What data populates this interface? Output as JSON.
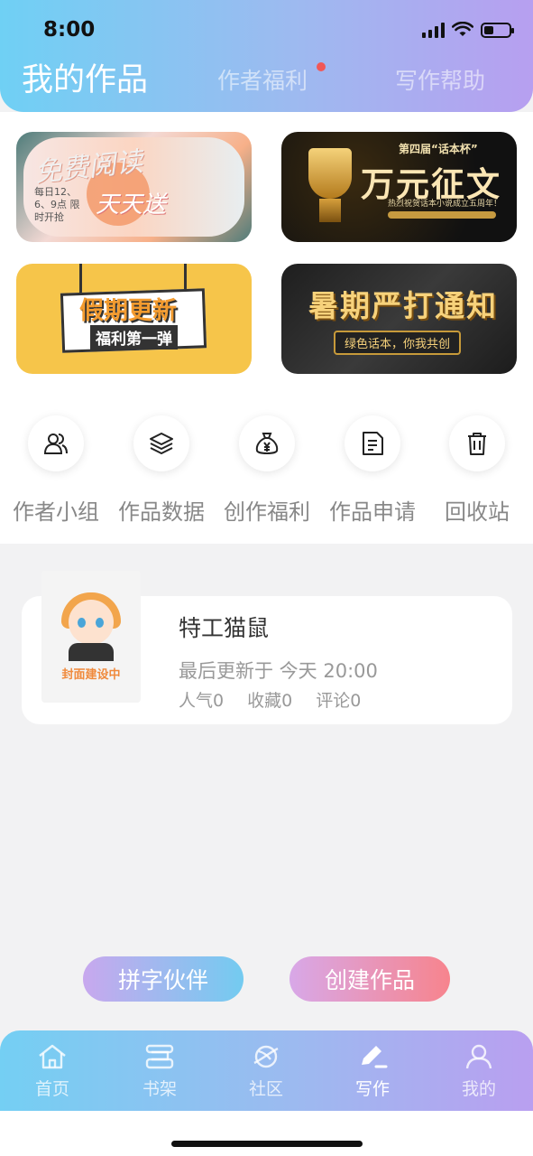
{
  "status_bar": {
    "time": "8:00"
  },
  "header": {
    "tabs": [
      {
        "label": "我的作品",
        "active": true
      },
      {
        "label": "作者福利",
        "active": false,
        "has_dot": true
      },
      {
        "label": "写作帮助",
        "active": false
      }
    ],
    "gradient_colors": [
      "#6fd0f4",
      "#b79ff0"
    ]
  },
  "banners": [
    {
      "title": "免费阅读",
      "subtitle": "天天送",
      "note": "每日12、6、9点 限时开抢"
    },
    {
      "edition": "第四届“话本杯”",
      "title": "万元征文",
      "note": "热烈祝贺话本小说成立五周年！"
    },
    {
      "title": "假期更新",
      "subtitle": "福利第一弹"
    },
    {
      "title": "暑期严打通知",
      "subtitle": "绿色话本，你我共创"
    }
  ],
  "shortcuts": [
    {
      "label": "作者小组",
      "icon": "users-icon"
    },
    {
      "label": "作品数据",
      "icon": "layers-icon"
    },
    {
      "label": "创作福利",
      "icon": "money-bag-icon"
    },
    {
      "label": "作品申请",
      "icon": "document-icon"
    },
    {
      "label": "回收站",
      "icon": "trash-icon"
    }
  ],
  "work": {
    "cover_caption": "封面建设中",
    "title": "特工猫鼠",
    "updated": "最后更新于 今天 20:00",
    "popularity": "人气0",
    "favorites": "收藏0",
    "comments": "评论0"
  },
  "actions": {
    "partner_label": "拼字伙伴",
    "create_label": "创建作品"
  },
  "bottom_nav": [
    {
      "label": "首页",
      "icon": "home-icon",
      "active": false
    },
    {
      "label": "书架",
      "icon": "bookshelf-icon",
      "active": false
    },
    {
      "label": "社区",
      "icon": "planet-icon",
      "active": false
    },
    {
      "label": "写作",
      "icon": "pen-icon",
      "active": true
    },
    {
      "label": "我的",
      "icon": "person-icon",
      "active": false
    }
  ]
}
